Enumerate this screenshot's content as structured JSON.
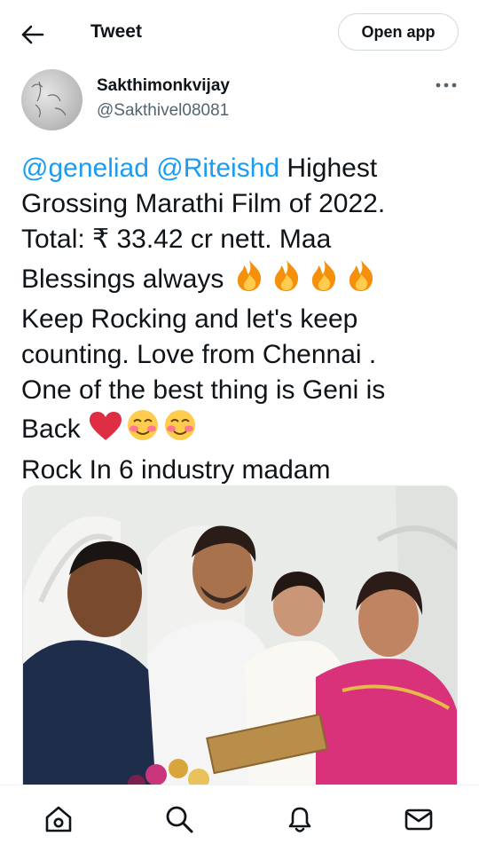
{
  "header": {
    "title": "Tweet",
    "open_app_label": "Open app"
  },
  "author": {
    "display_name": "Sakthimonkvijay",
    "handle": "@Sakthivel08081"
  },
  "tweet": {
    "mention_1": "@geneliad",
    "mention_2": "@Riteishd",
    "line1_rest": " Highest",
    "line2": "Grossing Marathi Film of 2022.",
    "line3": "Total: ₹ 33.42 cr nett. Maa",
    "line4": "Blessings always ",
    "line5": "Keep Rocking and let's keep",
    "line6": "counting.  Love from Chennai .",
    "line7": "One of the best thing is Geni is",
    "line8": "Back ",
    "line9": "Rock In 6 industry madam"
  },
  "icons": {
    "back": "arrow-left-icon",
    "more": "more-dots-icon",
    "fire": "fire-emoji",
    "heart": "red-heart-emoji",
    "smile": "smiling-blush-emoji",
    "home": "home-icon",
    "search": "search-icon",
    "notifications": "bell-icon",
    "messages": "mail-icon"
  },
  "colors": {
    "link": "#1d9bf0",
    "text": "#0f1419",
    "secondary": "#536471"
  }
}
